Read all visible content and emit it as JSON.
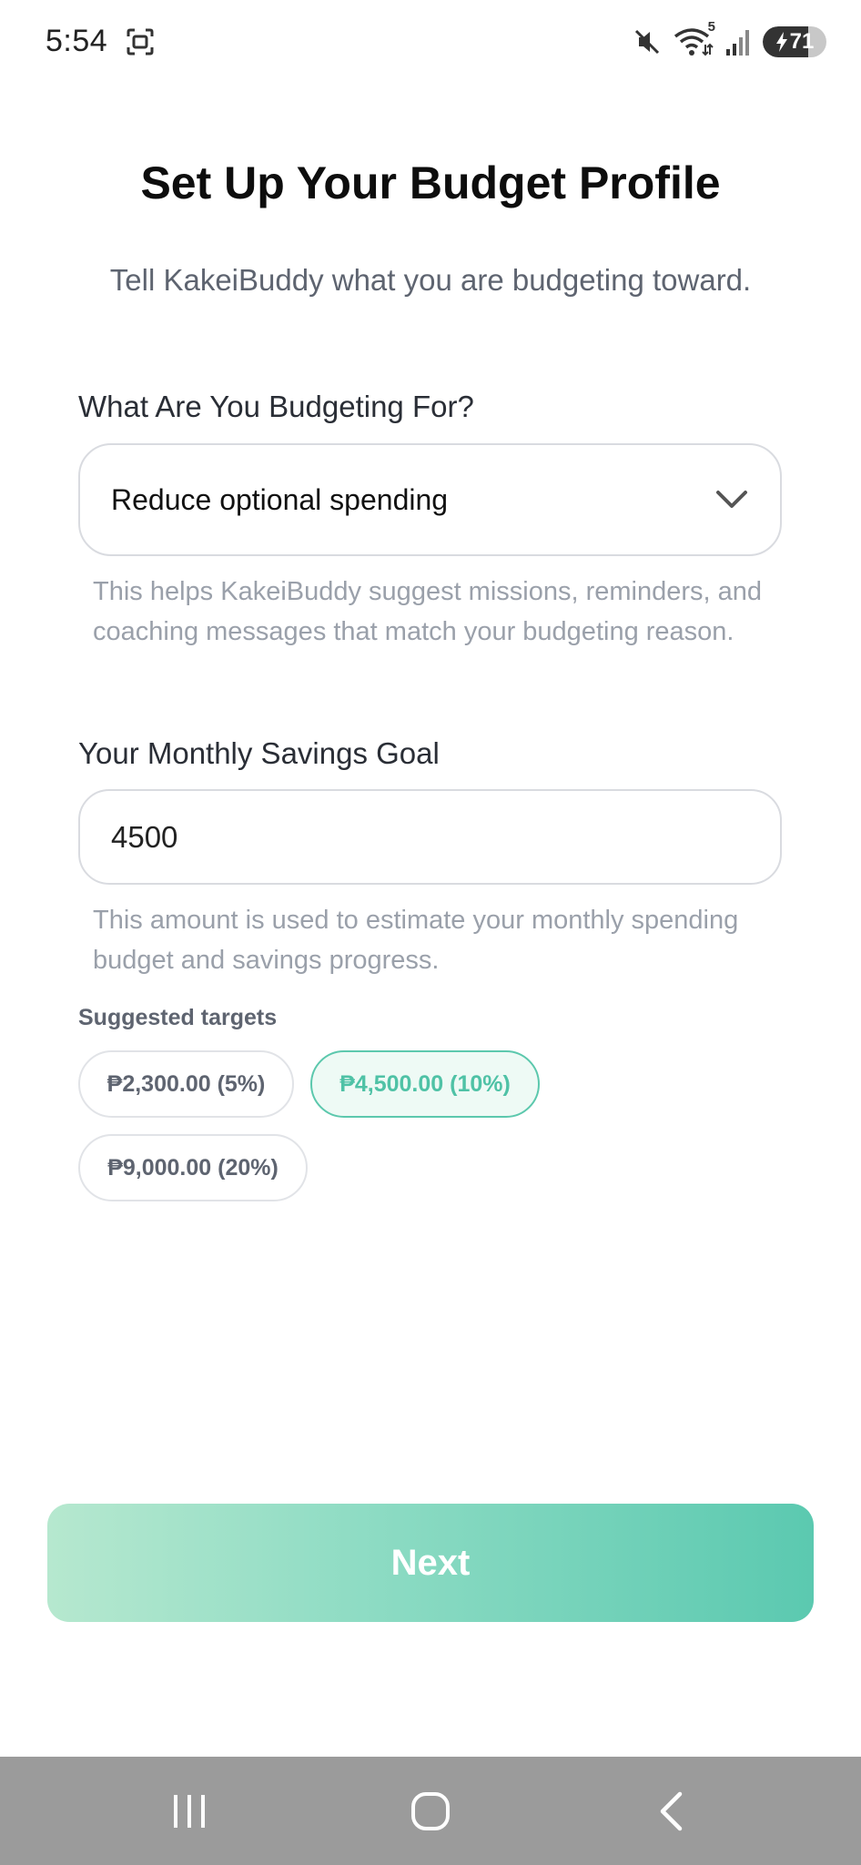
{
  "status_bar": {
    "time": "5:54",
    "battery_level": 71,
    "battery_text": "71",
    "wifi_badge": "5",
    "icons": [
      "screenshot-icon",
      "mute-icon",
      "wifi-icon",
      "signal-icon",
      "battery-charging-icon"
    ]
  },
  "header": {
    "title": "Set Up Your Budget Profile",
    "subtitle": "Tell KakeiBuddy what you are budgeting toward."
  },
  "purpose": {
    "label": "What Are You Budgeting For?",
    "selected_value": "Reduce optional spending",
    "helper": "This helps KakeiBuddy suggest missions, reminders, and coaching messages that match your budgeting reason."
  },
  "savings_goal": {
    "label": "Your Monthly Savings Goal",
    "value": "4500",
    "helper": "This amount is used to estimate your monthly spending budget and savings progress."
  },
  "suggestions": {
    "label": "Suggested targets",
    "chips": [
      {
        "label": "₱2,300.00 (5%)",
        "selected": false
      },
      {
        "label": "₱4,500.00 (10%)",
        "selected": true
      },
      {
        "label": "₱9,000.00 (20%)",
        "selected": false
      }
    ]
  },
  "actions": {
    "next_label": "Next"
  },
  "colors": {
    "accent": "#5bc9b0",
    "accent_light": "#b6e8cf",
    "muted_text": "#9aa0aa",
    "nav_bar": "#9b9b9b"
  }
}
